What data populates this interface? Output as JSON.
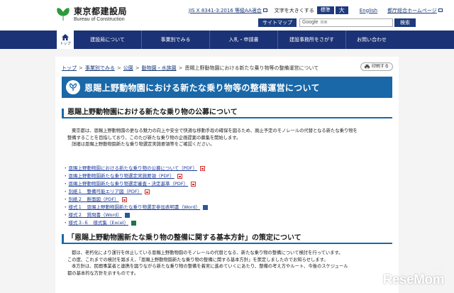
{
  "header": {
    "logo_jp": "東京都建設局",
    "logo_en": "Bureau of Construction",
    "jis_text": "JIS X 8341-3:2016 等級AA適合",
    "font_size_label": "文字を大きくする",
    "font_size_standard": "標準",
    "font_size_large": "大",
    "english_link": "English",
    "tokyo_home_link": "都庁総合ホームページ",
    "sitemap_label": "サイトマップ",
    "search_placeholder": "Google",
    "search_hint": "検索",
    "search_button": "検索"
  },
  "nav": {
    "home_label": "トップ",
    "items": [
      "建設局について",
      "事業別でみる",
      "入札・申請書",
      "建設事務所をさがす",
      "お問い合わせ"
    ]
  },
  "breadcrumb": {
    "items": [
      "トップ",
      "事業別でみる",
      "公園",
      "動物園・水族園"
    ],
    "current": "恩賜上野動物園における新たな乗り物等の整備運営について"
  },
  "print_label": "印刷する",
  "page_title": "恩賜上野動物園における新たな乗り物等の整備運営について",
  "section1": {
    "heading": "恩賜上野動物園における新たな乗り物の公募について",
    "para_lines": [
      "東京都は、恩賜上野動物園の更なる魅力の向上や安全で快適な移動手段の確保を図るため、廃止予定のモノレールの代替となる新たな乗り物を",
      "整備することを目指しており、このたび新たな乗り物の企画提案の募集を開始します。",
      "詳細は恩賜上野動物園新たな乗り物選定実施要領等をご確認ください。"
    ],
    "links": [
      {
        "text": "恩賜上野動物園における新たな乗り物の公募について（PDF）",
        "type": "pdf"
      },
      {
        "text": "恩賜上野動物園新たな乗り物選定実施要領（PDF）",
        "type": "pdf"
      },
      {
        "text": "恩賜上野動物園新たな乗り物選定審査・決定基準（PDF）",
        "type": "pdf"
      },
      {
        "text": "別紙１　整備可能エリア図（PDF）",
        "type": "pdf"
      },
      {
        "text": "別紙２　断面図（PDF）",
        "type": "pdf"
      },
      {
        "text": "様式１　恩賜上野動物園新たな乗り物選定参加表明書（Word）",
        "type": "word"
      },
      {
        "text": "様式２　質問書（Word）",
        "type": "word"
      },
      {
        "text": "様式３-６　様式集（Excel）",
        "type": "excel"
      }
    ]
  },
  "section2": {
    "heading": "「恩賜上野動物園新たな乗り物の整備に関する基本方針」の策定について",
    "para_lines": [
      "都は、老朽化により運行を休止している恩賜上野動物園のモノレールの代替となる、新たな乗り物の整備について検討を行っています。",
      "この度、これまでの検討を踏まえ、「恩賜上野動物園新たな乗り物の整備に関する基本方針」を策定しましたのでお知らせします。",
      "本方針は、民間事業者と連携を図りながら新たな乗り物の整備を着実に進めていくにあたり、整備の考え方やルート、今後のスケジュール",
      "都の基本的な方針を示すものです。"
    ]
  },
  "watermark": {
    "text": "ReseMom",
    "small": "リセマム"
  },
  "colors": {
    "nav_bg": "#1c3276",
    "title_bar": "#1a68a8",
    "link": "#1a3a9a"
  }
}
